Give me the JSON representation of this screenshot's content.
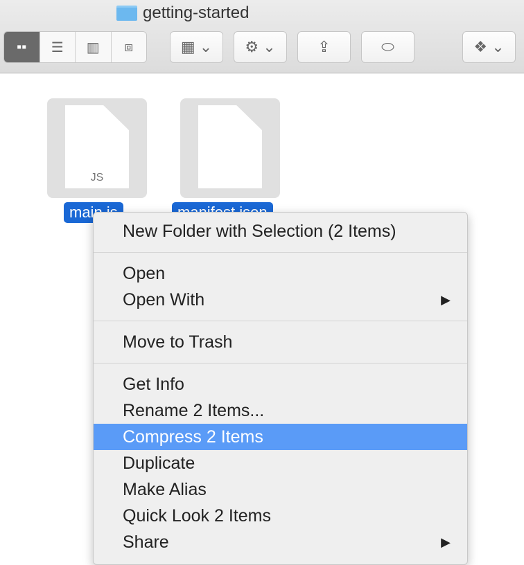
{
  "window": {
    "title": "getting-started"
  },
  "toolbar": {
    "view_buttons": [
      "icon",
      "list",
      "column",
      "cover-flow"
    ],
    "arrange": "arrange-menu",
    "action": "action-menu",
    "share": "share",
    "tags": "tags",
    "dropbox": "dropbox-menu"
  },
  "files": [
    {
      "name": "main.js",
      "badge": "JS"
    },
    {
      "name": "manifest.json"
    }
  ],
  "menu": {
    "groups": [
      [
        {
          "label": "New Folder with Selection (2 Items)"
        }
      ],
      [
        {
          "label": "Open"
        },
        {
          "label": "Open With",
          "submenu": true
        }
      ],
      [
        {
          "label": "Move to Trash"
        }
      ],
      [
        {
          "label": "Get Info"
        },
        {
          "label": "Rename 2 Items..."
        },
        {
          "label": "Compress 2 Items",
          "highlighted": true
        },
        {
          "label": "Duplicate"
        },
        {
          "label": "Make Alias"
        },
        {
          "label": "Quick Look 2 Items"
        },
        {
          "label": "Share",
          "submenu": true
        }
      ]
    ],
    "submenu_arrow": "▶"
  },
  "colors": {
    "selection": "#1a68d5",
    "highlight": "#5a9bf7"
  }
}
